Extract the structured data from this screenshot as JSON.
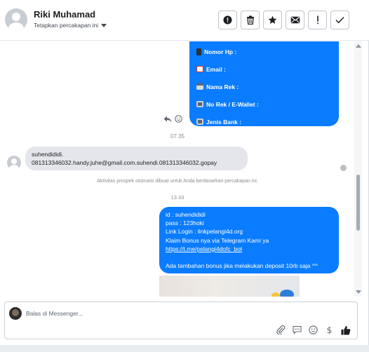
{
  "header": {
    "name": "Riki Muhamad",
    "subtitle": "Tetapkan percakapan ini",
    "actions": [
      {
        "id": "info",
        "glyph": "!",
        "icon": "info-circle-icon"
      },
      {
        "id": "delete",
        "icon": "trash-icon"
      },
      {
        "id": "star",
        "icon": "star-icon"
      },
      {
        "id": "mail",
        "icon": "envelope-icon"
      },
      {
        "id": "spam",
        "glyph": "!",
        "icon": "exclamation-icon"
      },
      {
        "id": "done",
        "icon": "checkmark-icon"
      }
    ]
  },
  "thread": {
    "form_fields": [
      {
        "label": "Nomor Hp :",
        "icon": "phone-icon"
      },
      {
        "label": "Email :",
        "icon": "mail-icon"
      },
      {
        "label": "Nama Rek :",
        "icon": "card-icon"
      },
      {
        "label": "No Rek / E-Wallet :",
        "icon": "atm-icon"
      },
      {
        "label": "Jenis Bank :",
        "icon": "atm-icon"
      }
    ],
    "time_1": "07.35",
    "incoming": {
      "line1": "suhendididi.",
      "line2": "081313346032.handy.juhe@gmail.com.suhendi.081313346032.gopay"
    },
    "system_note": "Aktivitas prospek otomatis dibuat untuk Anda berdasarkan percakapan ini.",
    "time_2": "13.33",
    "outgoing": {
      "lines": [
        "id : suhendididi",
        "pass : 123hoki",
        "Link Login : linkpelangi4d.org",
        "Klaim Bonus nya via Telegram Kami ya"
      ],
      "link": "https://t.me/pelangi4dofc_bot",
      "promo": "Ada tambahan bonus jika melakukan deposit 10rb saja ^^"
    }
  },
  "composer": {
    "placeholder": "Balas di Messenger..."
  },
  "colors": {
    "accent": "#0a7cff",
    "incoming_bg": "#e4e6eb"
  }
}
